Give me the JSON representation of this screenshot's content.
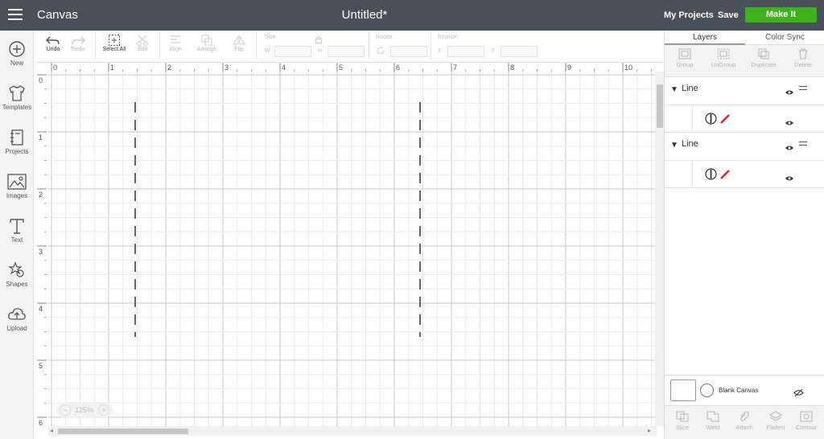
{
  "topbar": {
    "app_title": "Canvas",
    "doc_title": "Untitled*",
    "my_projects": "My Projects",
    "save": "Save",
    "make_it": "Make It",
    "make_it_color": "#3eb21a",
    "bar_color": "#4a5057"
  },
  "sidebar": {
    "items": [
      {
        "label": "New",
        "icon": "plus-circle-icon"
      },
      {
        "label": "Templates",
        "icon": "tshirt-icon"
      },
      {
        "label": "Projects",
        "icon": "notebook-icon"
      },
      {
        "label": "Images",
        "icon": "image-icon"
      },
      {
        "label": "Text",
        "icon": "text-icon"
      },
      {
        "label": "Shapes",
        "icon": "shapes-icon"
      },
      {
        "label": "Upload",
        "icon": "cloud-upload-icon"
      }
    ]
  },
  "toolbar": {
    "undo": "Undo",
    "redo": "Redo",
    "select_all": "Select All",
    "edit": "Edit",
    "align": "Align",
    "arrange": "Arrange",
    "flip": "Flip",
    "size": "Size",
    "w": "W",
    "h": "H",
    "rotate": "Rotate",
    "position": "Position",
    "x": "X",
    "y": "Y"
  },
  "canvas": {
    "ruler_top": [
      "0",
      "1",
      "2",
      "3",
      "4",
      "5",
      "6",
      "7",
      "8",
      "9",
      "10"
    ],
    "ruler_left": [
      "0",
      "1",
      "2",
      "3",
      "4",
      "5",
      "6"
    ],
    "zoom": "125%"
  },
  "panel": {
    "tabs": [
      "Layers",
      "Color Sync"
    ],
    "tools": [
      "Group",
      "UnGroup",
      "Duplicate",
      "Delete"
    ],
    "layers": [
      {
        "name": "Line",
        "line_color": "#e02020"
      },
      {
        "name": "Line",
        "line_color": "#e02020"
      }
    ],
    "blank_canvas": "Blank Canvas",
    "bottom_tools": [
      "Slice",
      "Weld",
      "Attach",
      "Flatten",
      "Contour"
    ]
  }
}
